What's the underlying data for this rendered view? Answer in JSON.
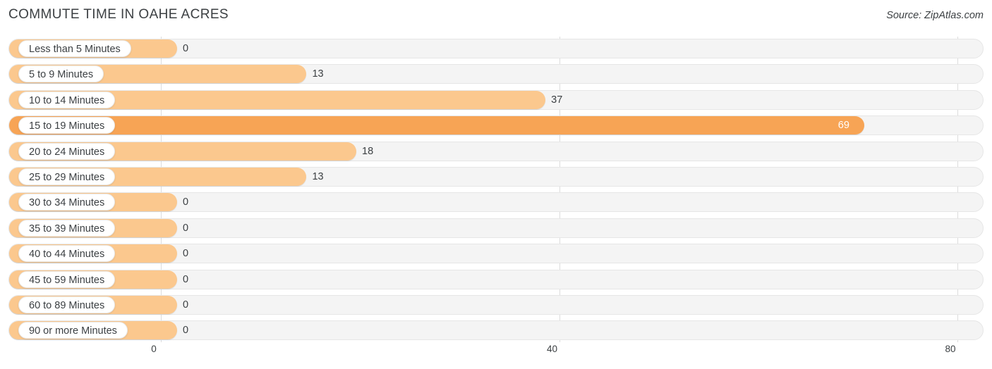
{
  "header": {
    "title": "COMMUTE TIME IN OAHE ACRES",
    "source": "Source: ZipAtlas.com"
  },
  "colors": {
    "bar": "#fbc88e",
    "bar_highlight": "#f7a455",
    "track": "#f4f4f4",
    "gridline": "#dcdcdc",
    "text": "#3c4043",
    "value_in_bar": "#ffffff"
  },
  "chart_data": {
    "type": "bar",
    "orientation": "horizontal",
    "title": "COMMUTE TIME IN OAHE ACRES",
    "subtitle": "",
    "xlabel": "",
    "ylabel": "",
    "xlim": [
      0,
      80
    ],
    "grid": true,
    "legend": null,
    "xticks": [
      0,
      40,
      80
    ],
    "xtick_labels": [
      "0",
      "40",
      "80"
    ],
    "categories": [
      "Less than 5 Minutes",
      "5 to 9 Minutes",
      "10 to 14 Minutes",
      "15 to 19 Minutes",
      "20 to 24 Minutes",
      "25 to 29 Minutes",
      "30 to 34 Minutes",
      "35 to 39 Minutes",
      "40 to 44 Minutes",
      "45 to 59 Minutes",
      "60 to 89 Minutes",
      "90 or more Minutes"
    ],
    "values": [
      0,
      13,
      37,
      69,
      18,
      13,
      0,
      0,
      0,
      0,
      0,
      0
    ],
    "value_labels": [
      "0",
      "13",
      "37",
      "69",
      "18",
      "13",
      "0",
      "0",
      "0",
      "0",
      "0",
      "0"
    ],
    "highlight_index": 3
  }
}
